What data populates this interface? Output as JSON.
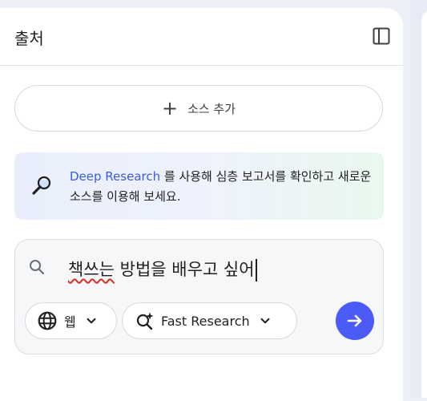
{
  "panel": {
    "title": "출처"
  },
  "add_source": {
    "label": "소스 추가"
  },
  "deep_research": {
    "link_text": "Deep Research",
    "description": " 를 사용해 심층 보고서를 확인하고 새로운 소스를 이용해 보세요."
  },
  "search": {
    "query_misspelled": "책쓰는",
    "query_rest": " 방법을 배우고 싶어",
    "source_chip_label": "웹",
    "mode_chip_label": "Fast Research"
  },
  "colors": {
    "accent": "#4a5cf5",
    "link": "#3d5bd9"
  },
  "icons": [
    "sidebar-toggle-icon",
    "plus-icon",
    "magnifier-icon",
    "search-icon",
    "globe-icon",
    "chevron-down-icon",
    "sparkle-search-icon",
    "arrow-right-icon"
  ]
}
